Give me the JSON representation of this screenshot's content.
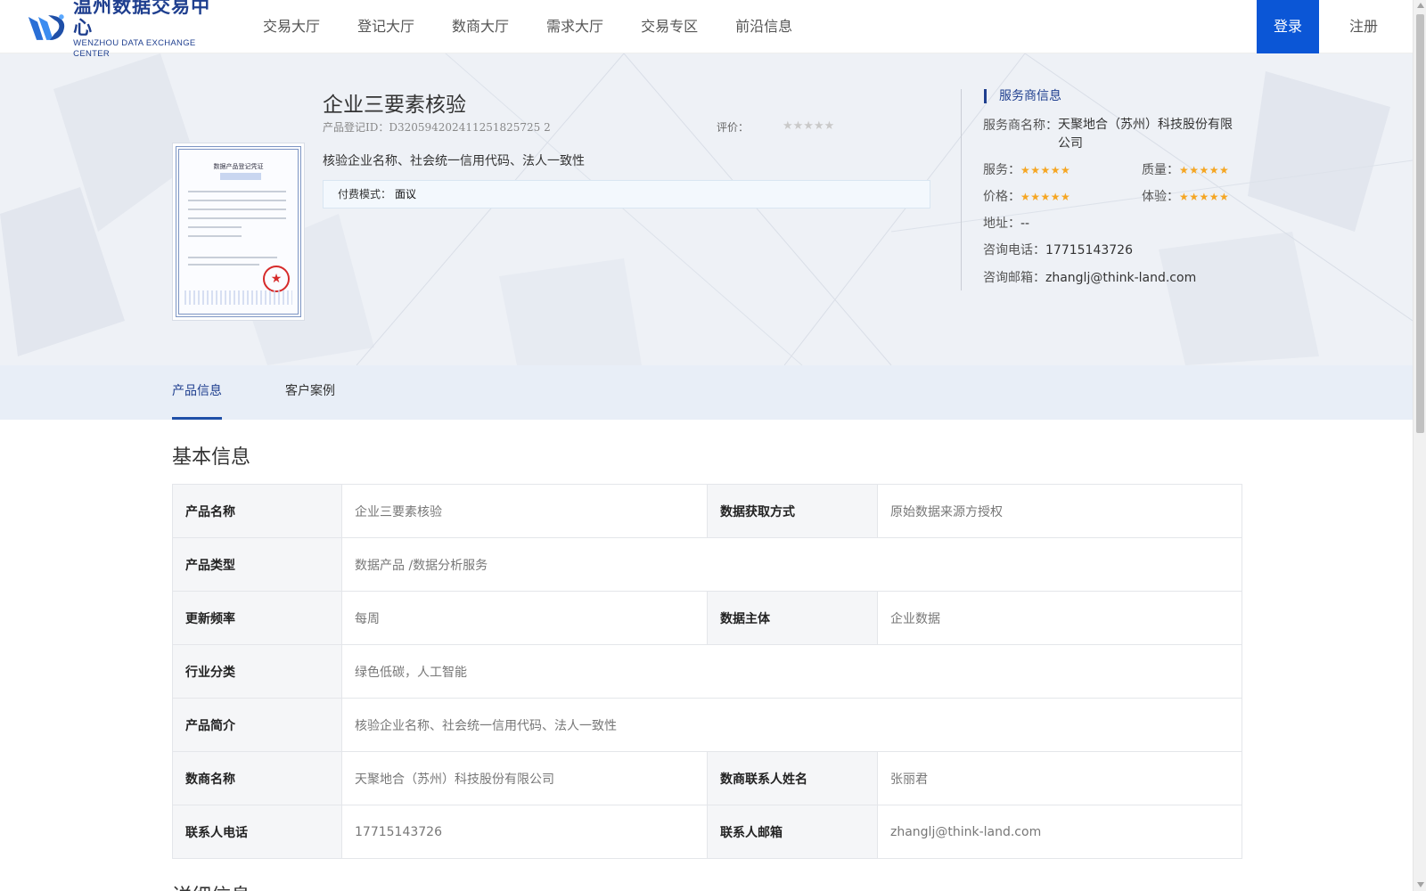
{
  "header": {
    "logo_cn": "温州数据交易中心",
    "logo_en": "WENZHOU DATA EXCHANGE CENTER",
    "nav": [
      "交易大厅",
      "登记大厅",
      "数商大厅",
      "需求大厅",
      "交易专区",
      "前沿信息"
    ],
    "login": "登录",
    "register": "注册"
  },
  "product": {
    "title": "企业三要素核验",
    "id": "产品登记ID：D320594202411251825725 2",
    "rating_label": "评价：",
    "rating_stars": "★★★★★",
    "rating_value": 0,
    "description": "核验企业名称、社会统一信用代码、法人一致性",
    "pay_label": "付费模式：",
    "pay_value": "面议",
    "certificate": {
      "title": "数据产品登记凭证",
      "seal_icon": "seal-star"
    }
  },
  "service": {
    "heading": "服务商信息",
    "name_label": "服务商名称：",
    "name_value": "天聚地合（苏州）科技股份有限公司",
    "service_label": "服务：",
    "quality_label": "质量：",
    "price_label": "价格：",
    "experience_label": "体验：",
    "stars": "★★★★★",
    "service_rating": 5,
    "quality_rating": 5,
    "price_rating": 5,
    "experience_rating": 5,
    "address_label": "地址：",
    "address_value": "--",
    "phone_label": "咨询电话：",
    "phone_value": "17715143726",
    "email_label": "咨询邮箱：",
    "email_value": "zhanglj@think-land.com"
  },
  "tabs": [
    "产品信息",
    "客户案例"
  ],
  "basic_info": {
    "title": "基本信息",
    "rows": [
      {
        "k1": "产品名称",
        "v1": "企业三要素核验",
        "k2": "数据获取方式",
        "v2": "原始数据来源方授权"
      },
      {
        "k1": "产品类型",
        "v1": "数据产品 /数据分析服务"
      },
      {
        "k1": "更新频率",
        "v1": "每周",
        "k2": "数据主体",
        "v2": "企业数据"
      },
      {
        "k1": "行业分类",
        "v1": "绿色低碳，人工智能"
      },
      {
        "k1": "产品简介",
        "v1": "核验企业名称、社会统一信用代码、法人一致性"
      },
      {
        "k1": "数商名称",
        "v1": "天聚地合（苏州）科技股份有限公司",
        "k2": "数商联系人姓名",
        "v2": "张丽君"
      },
      {
        "k1": "联系人电话",
        "v1": "17715143726",
        "k2": "联系人邮箱",
        "v2": "zhanglj@think-land.com"
      }
    ]
  },
  "detail_title": "详细信息",
  "colors": {
    "brand": "#1f3f8f",
    "login_bg": "#0b56d6",
    "star": "#f5a623",
    "hero_bg": "#eef1f6",
    "tab_bg": "#e8eef7"
  }
}
